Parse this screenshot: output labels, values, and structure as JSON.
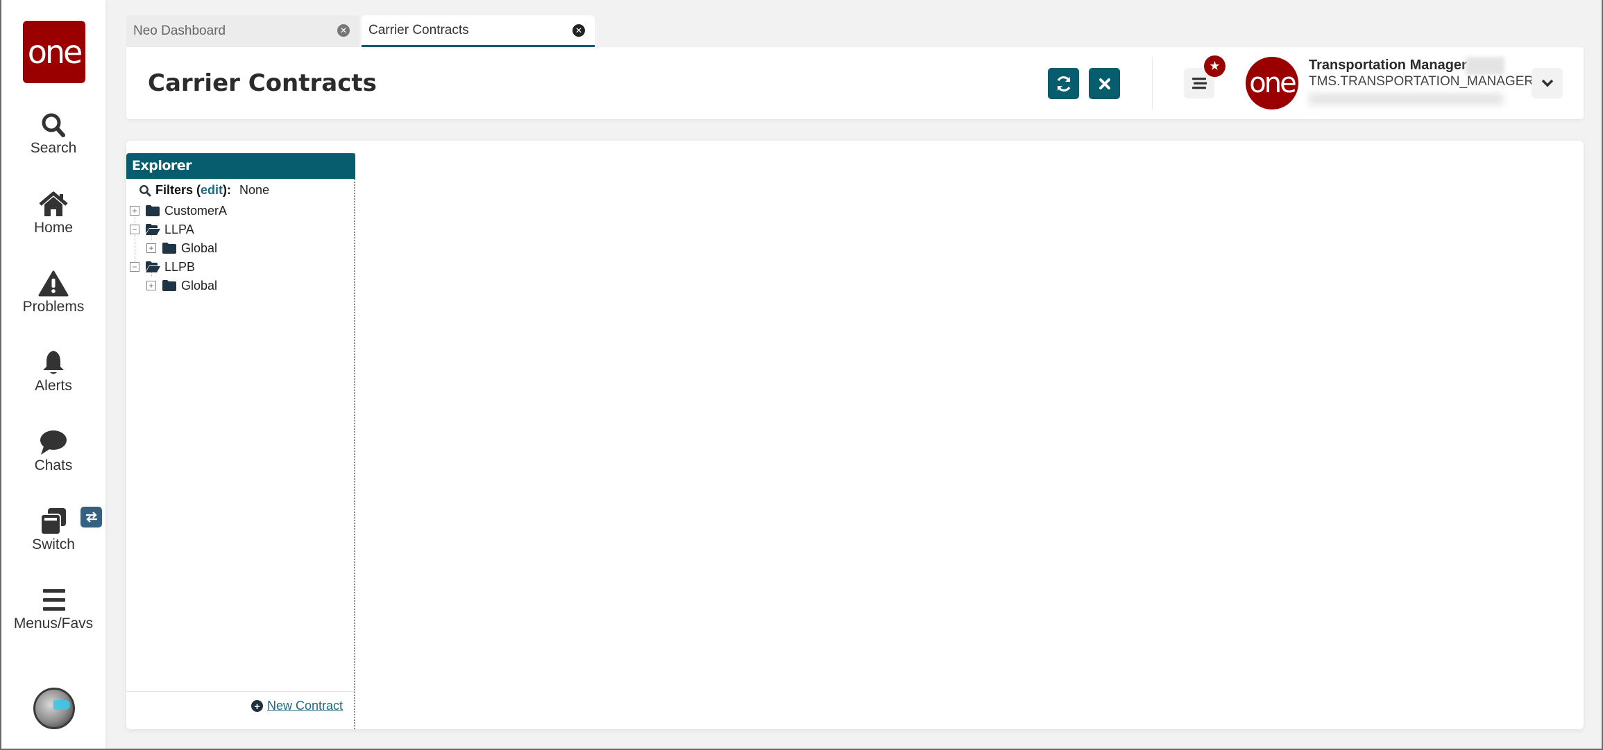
{
  "sidebar": {
    "logo_text": "one",
    "items": [
      {
        "label": "Search",
        "icon": "search-icon"
      },
      {
        "label": "Home",
        "icon": "home-icon"
      },
      {
        "label": "Problems",
        "icon": "warning-icon"
      },
      {
        "label": "Alerts",
        "icon": "bell-icon"
      },
      {
        "label": "Chats",
        "icon": "chat-icon"
      },
      {
        "label": "Switch",
        "icon": "windows-icon"
      },
      {
        "label": "Menus/Favs",
        "icon": "hamburger-icon"
      }
    ],
    "switch_badge_icon": "swap-arrows-icon",
    "bottom_avatar": "assistant-avatar"
  },
  "tabs": [
    {
      "label": "Neo Dashboard",
      "active": false
    },
    {
      "label": "Carrier Contracts",
      "active": true
    }
  ],
  "header": {
    "title": "Carrier Contracts",
    "refresh_icon": "refresh-icon",
    "close_icon": "close-icon",
    "menu_icon": "hamburger-icon",
    "favorite_badge_icon": "star-icon",
    "avatar_text": "one",
    "user_name": "Transportation Manager",
    "user_role": "TMS.TRANSPORTATION_MANAGER",
    "dropdown_icon": "chevron-down-icon"
  },
  "explorer": {
    "title": "Explorer",
    "filters_label": "Filters",
    "filters_edit": "edit",
    "filters_value": "None",
    "tree": [
      {
        "label": "CustomerA",
        "level": 0,
        "expanded": false
      },
      {
        "label": "LLPA",
        "level": 0,
        "expanded": true
      },
      {
        "label": "Global",
        "level": 1,
        "expanded": false
      },
      {
        "label": "LLPB",
        "level": 0,
        "expanded": true
      },
      {
        "label": "Global",
        "level": 1,
        "expanded": false
      }
    ],
    "new_contract_label": "New Contract"
  },
  "colors": {
    "brand_red": "#9b0000",
    "accent_teal": "#075c6e",
    "link": "#1b6a84",
    "switch_badge": "#35607f"
  }
}
